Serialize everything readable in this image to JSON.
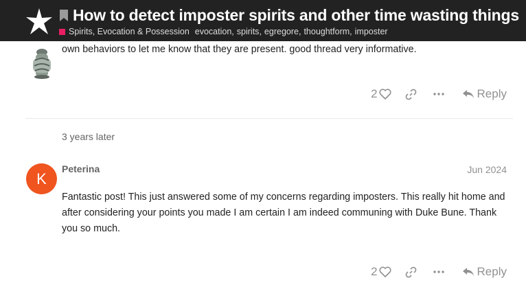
{
  "header": {
    "title": "How to detect imposter spirits and other time wasting things",
    "category": "Spirits, Evocation & Possession",
    "tags": [
      "evocation",
      "spirits",
      "egregore",
      "thoughtform",
      "imposter"
    ],
    "category_color": "#e91e63",
    "logo_icon": "star-logo-icon",
    "bookmark_icon": "bookmark-icon"
  },
  "posts": [
    {
      "text": "own behaviors to let me know that they are present. good thread very informative.",
      "likes": "2",
      "reply_label": "Reply"
    },
    {
      "avatar_letter": "K",
      "avatar_color": "#f0541f",
      "username": "Peterina",
      "date": "Jun 2024",
      "text": "Fantastic post! This just answered some of my concerns regarding imposters. This really hit home and after considering your points you made I am certain I am indeed communing with Duke Bune. Thank you so much.",
      "likes": "2",
      "reply_label": "Reply"
    }
  ],
  "time_gap": "3 years later"
}
